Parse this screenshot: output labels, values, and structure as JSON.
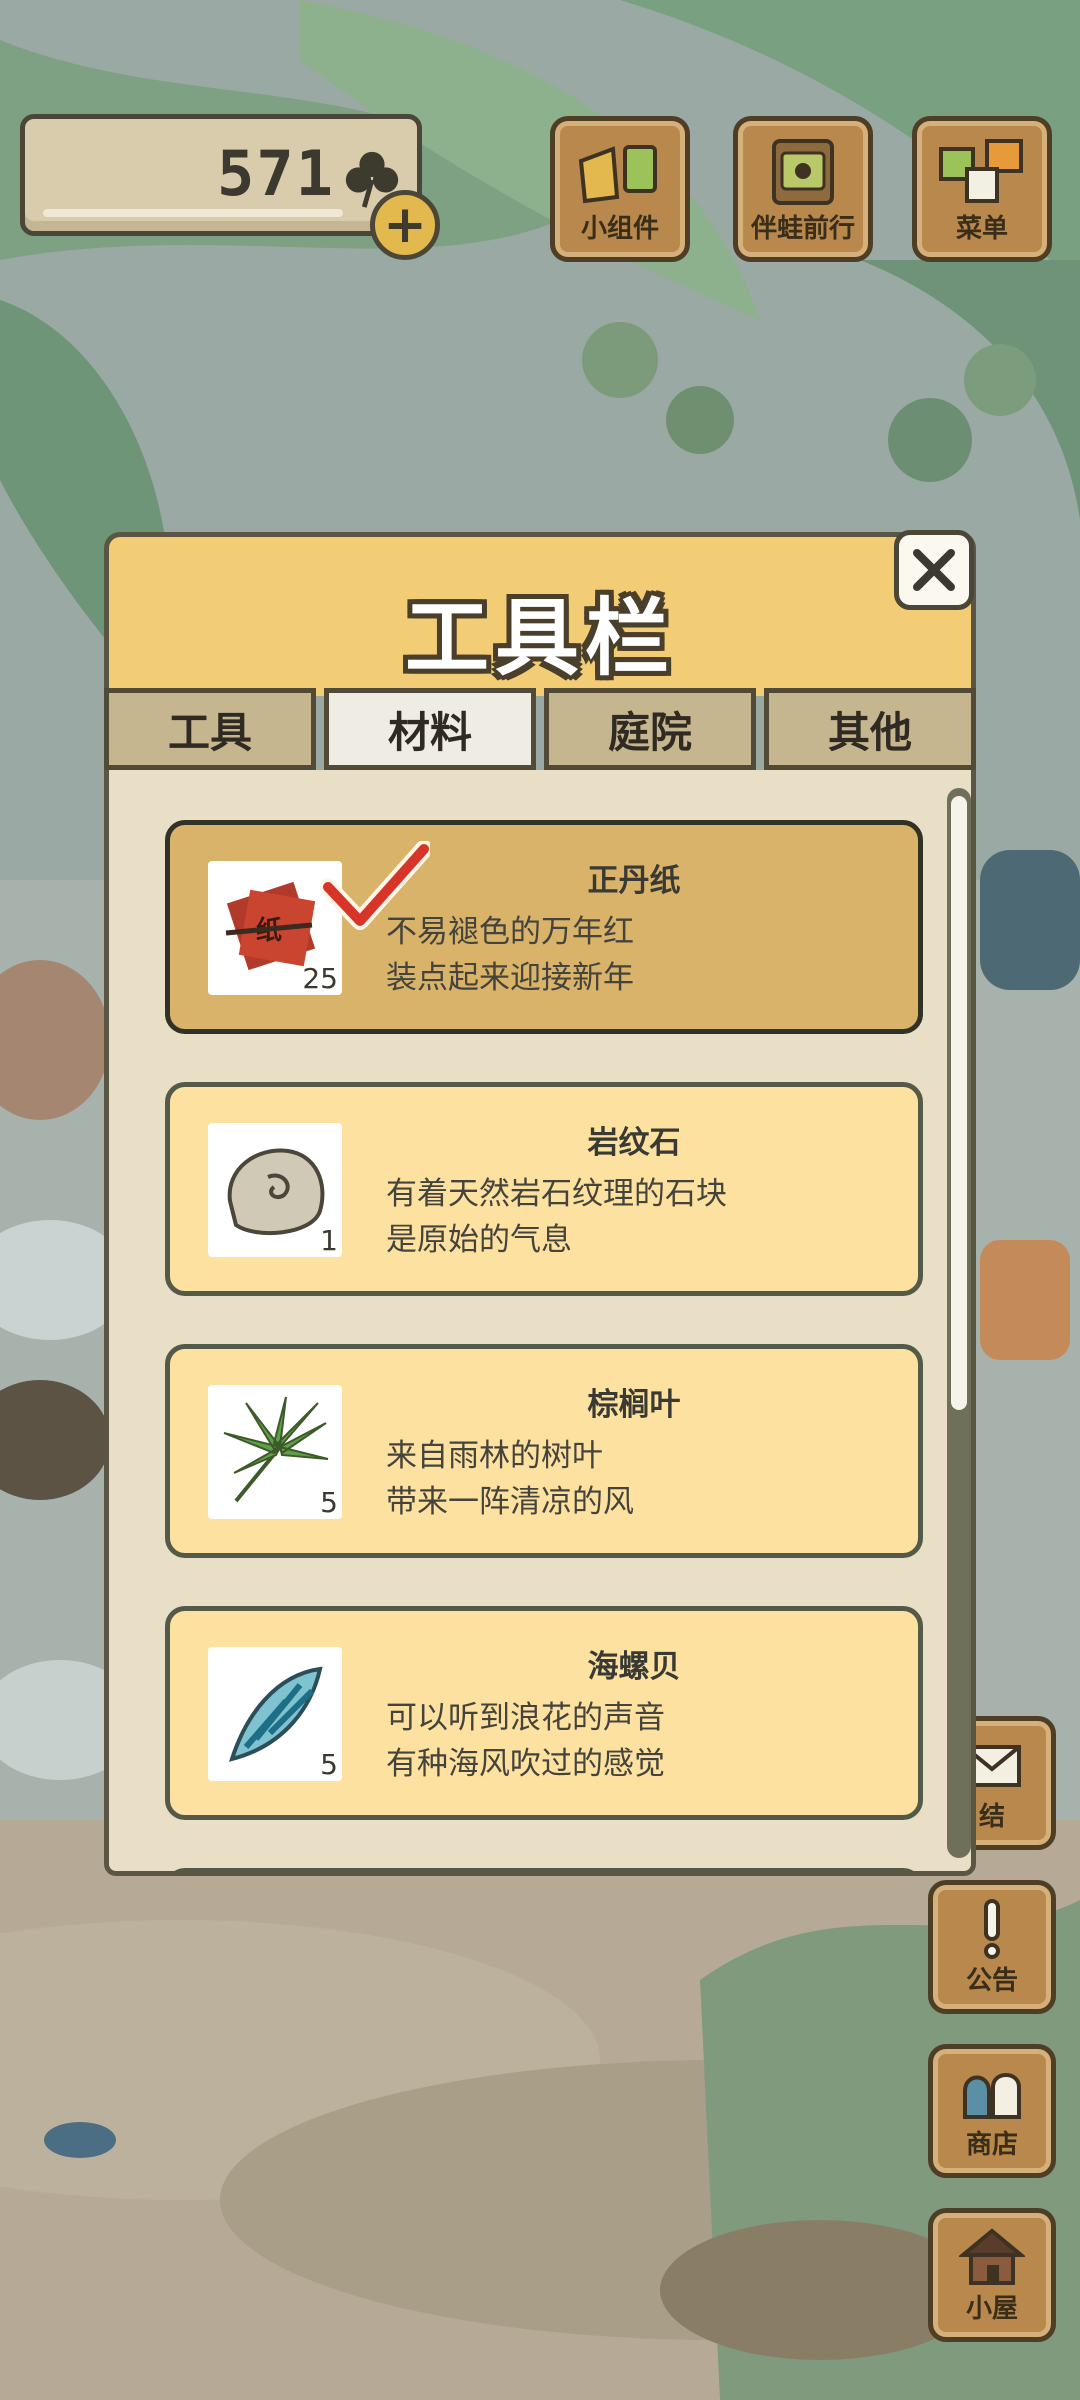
{
  "currency": {
    "clover_count": "571",
    "add_symbol": "+"
  },
  "top_buttons": [
    {
      "id": "widgets",
      "label": "小组件",
      "icon": "widget-icon"
    },
    {
      "id": "frog-adventure",
      "label": "伴蛙前行",
      "icon": "frog-adventure-icon"
    },
    {
      "id": "menu",
      "label": "菜单",
      "icon": "menu-icon"
    }
  ],
  "side_buttons": [
    {
      "id": "mail",
      "label": "结",
      "icon": "mail-icon"
    },
    {
      "id": "notice",
      "label": "公告",
      "icon": "exclamation-icon"
    },
    {
      "id": "shop",
      "label": "商店",
      "icon": "shop-icon"
    },
    {
      "id": "house",
      "label": "小屋",
      "icon": "house-icon"
    }
  ],
  "dialog": {
    "title": "工具栏",
    "close_icon": "close-icon",
    "tabs": [
      {
        "label": "工具",
        "active": false
      },
      {
        "label": "材料",
        "active": true
      },
      {
        "label": "庭院",
        "active": false
      },
      {
        "label": "其他",
        "active": false
      }
    ],
    "items": [
      {
        "name": "正丹纸",
        "desc1": "不易褪色的万年红",
        "desc2": "装点起来迎接新年",
        "qty": "25",
        "selected": true,
        "icon": "red-paper-icon"
      },
      {
        "name": "岩纹石",
        "desc1": "有着天然岩石纹理的石块",
        "desc2": "是原始的气息",
        "qty": "1",
        "selected": false,
        "icon": "stone-icon"
      },
      {
        "name": "棕榈叶",
        "desc1": "来自雨林的树叶",
        "desc2": "带来一阵清凉的风",
        "qty": "5",
        "selected": false,
        "icon": "palm-leaf-icon"
      },
      {
        "name": "海螺贝",
        "desc1": "可以听到浪花的声音",
        "desc2": "有种海风吹过的感觉",
        "qty": "5",
        "selected": false,
        "icon": "conch-shell-icon"
      }
    ]
  },
  "colors": {
    "dialog_header": "#f3cd76",
    "item_bg": "#fde1a0",
    "item_selected_bg": "#d9b36a",
    "check_red": "#d8352a"
  }
}
